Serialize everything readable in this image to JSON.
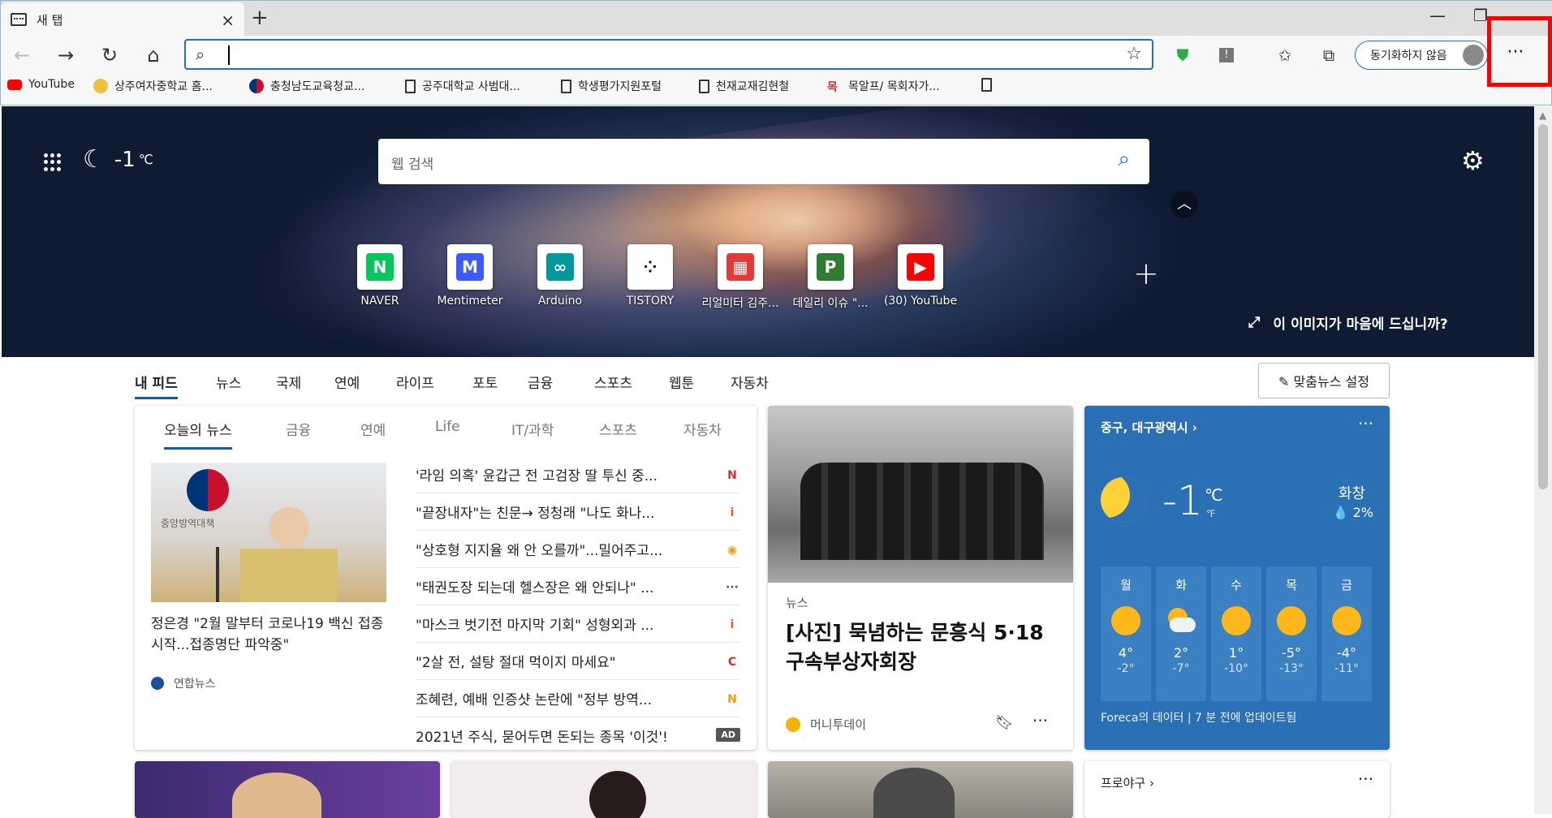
{
  "window": {
    "tab_title": "새 탭",
    "tab_close": "×",
    "new_tab": "+",
    "minimize": "—",
    "maximize": "❐"
  },
  "toolbar": {
    "address_value": "",
    "sync_label": "동기화하지 않음",
    "more_label": "···"
  },
  "bookmarks": [
    {
      "label": "YouTube",
      "icon": "youtube-icon",
      "color": "#ff0000"
    },
    {
      "label": "상주여자중학교 홈...",
      "icon": "school-icon"
    },
    {
      "label": "충청남도교육청교...",
      "icon": "taeguk-icon"
    },
    {
      "label": "공주대학교 사범대...",
      "icon": "document-icon"
    },
    {
      "label": "학생평가지원포털",
      "icon": "document-icon"
    },
    {
      "label": "천재교재김현철",
      "icon": "document-icon"
    },
    {
      "label": "목알프/ 목회자가...",
      "icon": "mok-icon",
      "badge": "목"
    },
    {
      "label": "",
      "icon": "document-icon"
    }
  ],
  "hero": {
    "temperature": "-1",
    "unit": "℃",
    "search_placeholder": "웹 검색",
    "like_image_label": "이 이미지가 마음에 드십니까?"
  },
  "tiles": [
    {
      "label": "NAVER",
      "icon": "naver-icon",
      "color": "#03c75a",
      "glyph": "N"
    },
    {
      "label": "Mentimeter",
      "icon": "mentimeter-icon",
      "color": "#3d5afe",
      "glyph": "M"
    },
    {
      "label": "Arduino",
      "icon": "arduino-icon",
      "color": "#00979d",
      "glyph": "∞"
    },
    {
      "label": "TISTORY",
      "icon": "tistory-icon",
      "color": "#111111",
      "glyph": "⁘"
    },
    {
      "label": "리얼미터 김주...",
      "icon": "realmeter-icon",
      "color": "#e53935",
      "glyph": "▦"
    },
    {
      "label": "데일리 이슈 \"...",
      "icon": "daily-issue-icon",
      "color": "#2e7d32",
      "glyph": "P"
    },
    {
      "label": "(30) YouTube",
      "icon": "youtube-icon",
      "color": "#ff0000",
      "glyph": "▶"
    }
  ],
  "feed_tabs": [
    "내 피드",
    "뉴스",
    "국제",
    "연예",
    "라이프",
    "포토",
    "금융",
    "스포츠",
    "웹툰",
    "자동차"
  ],
  "custom_news_label": "✎ 맞춤뉴스 설정",
  "news_card": {
    "tabs": [
      "오늘의 뉴스",
      "금융",
      "연예",
      "Life",
      "IT/과학",
      "스포츠",
      "자동차"
    ],
    "featured": {
      "title": "정은경 \"2월 말부터 코로나19 백신 접종 시작...접종명단 파악중\"",
      "source": "연합뉴스",
      "image_text": "중앙방역대책"
    },
    "items": [
      {
        "text": "'라임 의혹' 윤갑근 전 고검장 딸 투신 중...",
        "color": "#d32f2f",
        "glyph": "N"
      },
      {
        "text": "\"끝장내자\"는 친문→ 정청래 \"나도 화나...",
        "color": "#ef5a24",
        "glyph": "i"
      },
      {
        "text": "\"상호형 지지율 왜 안 오를까\"...밀어주고...",
        "color": "#f39c12",
        "glyph": "◉"
      },
      {
        "text": "\"태권도장 되는데 헬스장은 왜 안되나\" ...",
        "color": "#555555",
        "glyph": "···"
      },
      {
        "text": "\"마스크 벗기전 마지막 기회\" 성형외과 ...",
        "color": "#ef5a24",
        "glyph": "i"
      },
      {
        "text": "\"2살 전, 설탕 절대 먹이지 마세요\"",
        "color": "#d32f2f",
        "glyph": "C"
      },
      {
        "text": "조혜련, 예배 인증샷 논란에 \"정부 방역...",
        "color": "#f39c12",
        "glyph": "N"
      },
      {
        "text": "2021년 주식, 묻어두면 돈되는 종목 '이것'!",
        "ad": "AD"
      }
    ]
  },
  "photo_card": {
    "category": "뉴스",
    "title": "[사진] 묵념하는 문흥식 5·18구속부상자회장",
    "source": "머니투데이"
  },
  "weather_card": {
    "location": "중구, 대구광역시 ›",
    "more": "···",
    "temp": "-1",
    "unit_c": "℃",
    "unit_f": "℉",
    "condition": "화창",
    "rain": "💧 2%",
    "forecast": [
      {
        "day": "월",
        "hi": "4°",
        "lo": "-2°",
        "icon": "sun-icon"
      },
      {
        "day": "화",
        "hi": "2°",
        "lo": "-7°",
        "icon": "partly-cloudy-icon"
      },
      {
        "day": "수",
        "hi": "1°",
        "lo": "-10°",
        "icon": "sun-icon"
      },
      {
        "day": "목",
        "hi": "-5°",
        "lo": "-13°",
        "icon": "sun-icon"
      },
      {
        "day": "금",
        "hi": "-4°",
        "lo": "-11°",
        "icon": "sun-icon"
      }
    ],
    "footer": "Foreca의 데이터 | 7 분 전에 업데이트됨"
  },
  "baseball_card": {
    "title": "프로야구 ›",
    "more": "···"
  }
}
